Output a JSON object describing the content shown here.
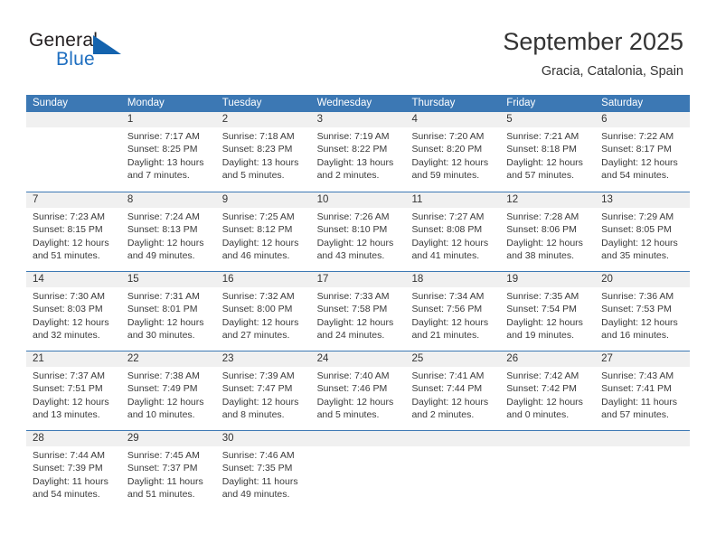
{
  "brand": {
    "name_part1": "General",
    "name_part2": "Blue",
    "triangle_icon": "triangle-icon"
  },
  "header": {
    "month_title": "September 2025",
    "location": "Gracia, Catalonia, Spain"
  },
  "colors": {
    "header_blue": "#3c78b4",
    "brand_blue": "#1463ae",
    "daynum_band": "#f0f0f0",
    "text": "#333333"
  },
  "weekdays": [
    "Sunday",
    "Monday",
    "Tuesday",
    "Wednesday",
    "Thursday",
    "Friday",
    "Saturday"
  ],
  "weeks": [
    [
      {
        "day": "",
        "empty": true
      },
      {
        "day": "1",
        "sunrise": "Sunrise: 7:17 AM",
        "sunset": "Sunset: 8:25 PM",
        "daylight": "Daylight: 13 hours and 7 minutes."
      },
      {
        "day": "2",
        "sunrise": "Sunrise: 7:18 AM",
        "sunset": "Sunset: 8:23 PM",
        "daylight": "Daylight: 13 hours and 5 minutes."
      },
      {
        "day": "3",
        "sunrise": "Sunrise: 7:19 AM",
        "sunset": "Sunset: 8:22 PM",
        "daylight": "Daylight: 13 hours and 2 minutes."
      },
      {
        "day": "4",
        "sunrise": "Sunrise: 7:20 AM",
        "sunset": "Sunset: 8:20 PM",
        "daylight": "Daylight: 12 hours and 59 minutes."
      },
      {
        "day": "5",
        "sunrise": "Sunrise: 7:21 AM",
        "sunset": "Sunset: 8:18 PM",
        "daylight": "Daylight: 12 hours and 57 minutes."
      },
      {
        "day": "6",
        "sunrise": "Sunrise: 7:22 AM",
        "sunset": "Sunset: 8:17 PM",
        "daylight": "Daylight: 12 hours and 54 minutes."
      }
    ],
    [
      {
        "day": "7",
        "sunrise": "Sunrise: 7:23 AM",
        "sunset": "Sunset: 8:15 PM",
        "daylight": "Daylight: 12 hours and 51 minutes."
      },
      {
        "day": "8",
        "sunrise": "Sunrise: 7:24 AM",
        "sunset": "Sunset: 8:13 PM",
        "daylight": "Daylight: 12 hours and 49 minutes."
      },
      {
        "day": "9",
        "sunrise": "Sunrise: 7:25 AM",
        "sunset": "Sunset: 8:12 PM",
        "daylight": "Daylight: 12 hours and 46 minutes."
      },
      {
        "day": "10",
        "sunrise": "Sunrise: 7:26 AM",
        "sunset": "Sunset: 8:10 PM",
        "daylight": "Daylight: 12 hours and 43 minutes."
      },
      {
        "day": "11",
        "sunrise": "Sunrise: 7:27 AM",
        "sunset": "Sunset: 8:08 PM",
        "daylight": "Daylight: 12 hours and 41 minutes."
      },
      {
        "day": "12",
        "sunrise": "Sunrise: 7:28 AM",
        "sunset": "Sunset: 8:06 PM",
        "daylight": "Daylight: 12 hours and 38 minutes."
      },
      {
        "day": "13",
        "sunrise": "Sunrise: 7:29 AM",
        "sunset": "Sunset: 8:05 PM",
        "daylight": "Daylight: 12 hours and 35 minutes."
      }
    ],
    [
      {
        "day": "14",
        "sunrise": "Sunrise: 7:30 AM",
        "sunset": "Sunset: 8:03 PM",
        "daylight": "Daylight: 12 hours and 32 minutes."
      },
      {
        "day": "15",
        "sunrise": "Sunrise: 7:31 AM",
        "sunset": "Sunset: 8:01 PM",
        "daylight": "Daylight: 12 hours and 30 minutes."
      },
      {
        "day": "16",
        "sunrise": "Sunrise: 7:32 AM",
        "sunset": "Sunset: 8:00 PM",
        "daylight": "Daylight: 12 hours and 27 minutes."
      },
      {
        "day": "17",
        "sunrise": "Sunrise: 7:33 AM",
        "sunset": "Sunset: 7:58 PM",
        "daylight": "Daylight: 12 hours and 24 minutes."
      },
      {
        "day": "18",
        "sunrise": "Sunrise: 7:34 AM",
        "sunset": "Sunset: 7:56 PM",
        "daylight": "Daylight: 12 hours and 21 minutes."
      },
      {
        "day": "19",
        "sunrise": "Sunrise: 7:35 AM",
        "sunset": "Sunset: 7:54 PM",
        "daylight": "Daylight: 12 hours and 19 minutes."
      },
      {
        "day": "20",
        "sunrise": "Sunrise: 7:36 AM",
        "sunset": "Sunset: 7:53 PM",
        "daylight": "Daylight: 12 hours and 16 minutes."
      }
    ],
    [
      {
        "day": "21",
        "sunrise": "Sunrise: 7:37 AM",
        "sunset": "Sunset: 7:51 PM",
        "daylight": "Daylight: 12 hours and 13 minutes."
      },
      {
        "day": "22",
        "sunrise": "Sunrise: 7:38 AM",
        "sunset": "Sunset: 7:49 PM",
        "daylight": "Daylight: 12 hours and 10 minutes."
      },
      {
        "day": "23",
        "sunrise": "Sunrise: 7:39 AM",
        "sunset": "Sunset: 7:47 PM",
        "daylight": "Daylight: 12 hours and 8 minutes."
      },
      {
        "day": "24",
        "sunrise": "Sunrise: 7:40 AM",
        "sunset": "Sunset: 7:46 PM",
        "daylight": "Daylight: 12 hours and 5 minutes."
      },
      {
        "day": "25",
        "sunrise": "Sunrise: 7:41 AM",
        "sunset": "Sunset: 7:44 PM",
        "daylight": "Daylight: 12 hours and 2 minutes."
      },
      {
        "day": "26",
        "sunrise": "Sunrise: 7:42 AM",
        "sunset": "Sunset: 7:42 PM",
        "daylight": "Daylight: 12 hours and 0 minutes."
      },
      {
        "day": "27",
        "sunrise": "Sunrise: 7:43 AM",
        "sunset": "Sunset: 7:41 PM",
        "daylight": "Daylight: 11 hours and 57 minutes."
      }
    ],
    [
      {
        "day": "28",
        "sunrise": "Sunrise: 7:44 AM",
        "sunset": "Sunset: 7:39 PM",
        "daylight": "Daylight: 11 hours and 54 minutes."
      },
      {
        "day": "29",
        "sunrise": "Sunrise: 7:45 AM",
        "sunset": "Sunset: 7:37 PM",
        "daylight": "Daylight: 11 hours and 51 minutes."
      },
      {
        "day": "30",
        "sunrise": "Sunrise: 7:46 AM",
        "sunset": "Sunset: 7:35 PM",
        "daylight": "Daylight: 11 hours and 49 minutes."
      },
      {
        "day": "",
        "empty": true
      },
      {
        "day": "",
        "empty": true
      },
      {
        "day": "",
        "empty": true
      },
      {
        "day": "",
        "empty": true
      }
    ]
  ]
}
